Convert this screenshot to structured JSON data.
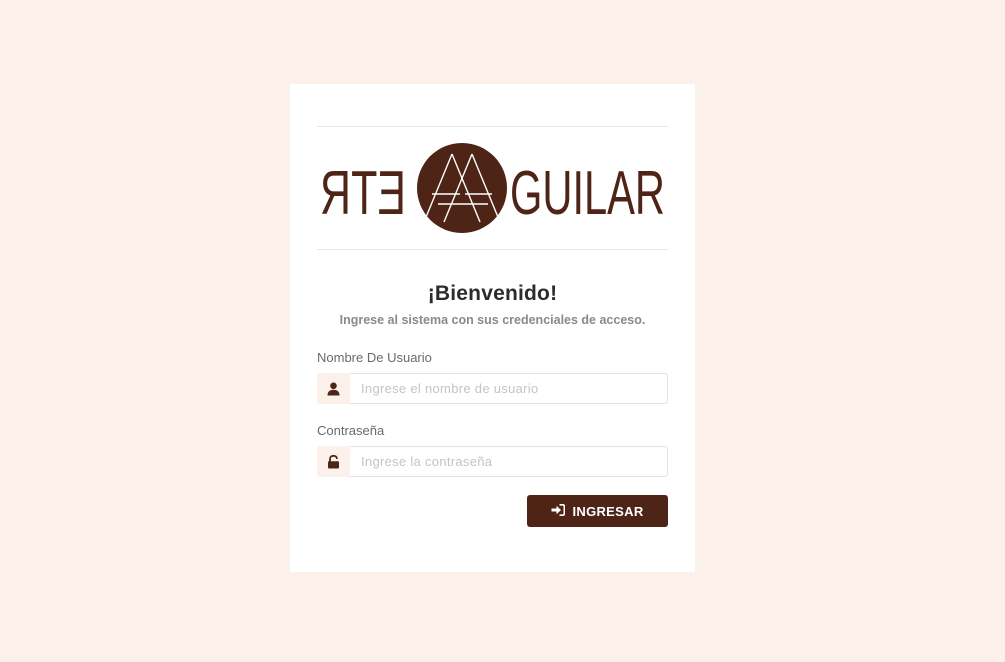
{
  "logo": {
    "left_text": "ETR",
    "right_text": "GUILAR",
    "circle_letters": "AA",
    "brand_color": "#4e2416"
  },
  "welcome": {
    "title": "¡Bienvenido!",
    "subtitle": "Ingrese al sistema con sus credenciales de acceso."
  },
  "username": {
    "label": "Nombre De Usuario",
    "placeholder": "Ingrese el nombre de usuario",
    "value": "",
    "icon": "user-icon"
  },
  "password": {
    "label": "Contraseña",
    "placeholder": "Ingrese la contraseña",
    "value": "",
    "icon": "unlock-icon"
  },
  "submit": {
    "label": "INGRESAR",
    "icon": "sign-in-icon"
  },
  "colors": {
    "background": "#fbf1ea",
    "card": "#ffffff",
    "accent": "#4e2416"
  }
}
